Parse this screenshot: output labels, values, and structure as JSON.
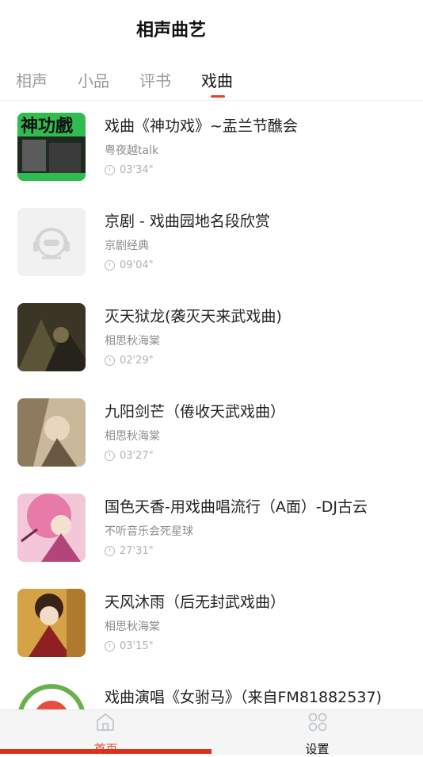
{
  "app": {
    "title": "相声曲艺"
  },
  "tabs": [
    "相声",
    "小品",
    "评书",
    "戏曲"
  ],
  "active_tab": "戏曲",
  "items": [
    {
      "title": "戏曲《神功戏》~盂兰节醮会",
      "author": "粤夜越talk",
      "duration": "03'34\""
    },
    {
      "title": "京剧 - 戏曲园地名段欣赏",
      "author": "京剧经典",
      "duration": "09'04\""
    },
    {
      "title": "灭天狱龙(袭灭天来武戏曲)",
      "author": "相思秋海棠",
      "duration": "02'29\""
    },
    {
      "title": "九阳剑芒（倦收天武戏曲）",
      "author": "相思秋海棠",
      "duration": "03'27\""
    },
    {
      "title": "国色天香-用戏曲唱流行（A面）-DJ古云",
      "author": "不听音乐会死星球",
      "duration": "27'31\""
    },
    {
      "title": "天风沐雨（后无封武戏曲）",
      "author": "相思秋海棠",
      "duration": "03'15\""
    },
    {
      "title": "戏曲演唱《女驸马》（来自FM81882537)",
      "author": "",
      "duration": ""
    }
  ],
  "nav": {
    "home": "首页",
    "settings": "设置"
  },
  "colors": {
    "accent": "#e8412c"
  }
}
